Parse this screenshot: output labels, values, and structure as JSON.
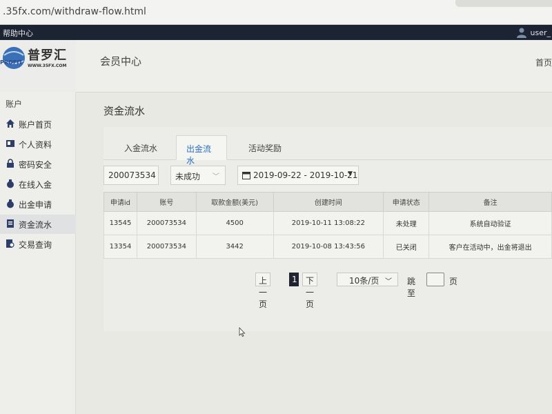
{
  "browser": {
    "url": ".35fx.com/withdraw-flow.html"
  },
  "topbar": {
    "help": "帮助中心",
    "user": "user_"
  },
  "header": {
    "logo_cn": "普罗汇",
    "logo_en": "WWW.35FX.COM",
    "logo_profit": "PROFIT",
    "title": "会员中心",
    "home": "首页"
  },
  "sidebar": {
    "group": "账户",
    "items": [
      {
        "label": "账户首页",
        "icon": "home-icon"
      },
      {
        "label": "个人资料",
        "icon": "id-card-icon"
      },
      {
        "label": "密码安全",
        "icon": "lock-icon"
      },
      {
        "label": "在线入金",
        "icon": "money-bag-icon"
      },
      {
        "label": "出金申请",
        "icon": "money-bag-icon"
      },
      {
        "label": "资金流水",
        "icon": "ledger-icon"
      },
      {
        "label": "交易查询",
        "icon": "search-doc-icon"
      }
    ]
  },
  "main": {
    "title": "资金流水",
    "tabs": [
      "入金流水",
      "出金流水",
      "活动奖励"
    ],
    "filters": {
      "account": "200073534",
      "status": "未成功",
      "date_range": "2019-09-22 - 2019-10-21"
    },
    "table": {
      "headers": [
        "申请id",
        "账号",
        "取款金额(美元)",
        "创建时间",
        "申请状态",
        "备注"
      ],
      "rows": [
        [
          "13545",
          "200073534",
          "4500",
          "2019-10-11 13:08:22",
          "未处理",
          "系统自动验证"
        ],
        [
          "13354",
          "200073534",
          "3442",
          "2019-10-08 13:43:56",
          "已关闭",
          "客户在活动中，出金将退出"
        ]
      ]
    },
    "pager": {
      "prev": "上一页",
      "current": "1",
      "next": "下一页",
      "per_page": "10条/页",
      "jump_label": "跳至",
      "page_unit": "页"
    }
  },
  "colors": {
    "topbar": "#1c2332",
    "active_tab": "#2b6fc2"
  }
}
